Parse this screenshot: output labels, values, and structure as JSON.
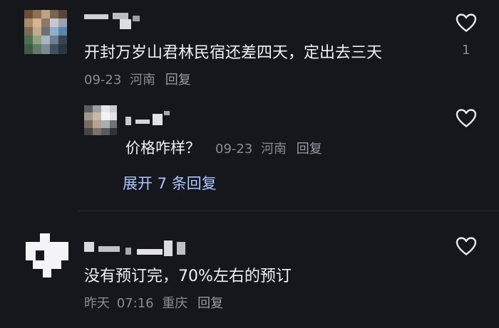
{
  "comments": [
    {
      "text": "开封万岁山君林民宿还差四天，定出去三天",
      "date": "09-23",
      "location": "河南",
      "reply_label": "回复",
      "like_icon": "heart-outline-icon",
      "like_count": "1"
    }
  ],
  "replies": [
    {
      "text": "价格咋样？",
      "date": "09-23",
      "location": "河南",
      "reply_label": "回复",
      "like_icon": "heart-outline-icon"
    }
  ],
  "expand_label": "展开 7 条回复",
  "comment2": {
    "text": "没有预订完，70%左右的预订",
    "date": "昨天",
    "time": "07:16",
    "location": "重庆",
    "reply_label": "回复",
    "like_icon": "heart-outline-icon"
  },
  "colors": {
    "background": "#16161d",
    "text": "#f0f0f4",
    "meta": "#8b8b95",
    "link": "#a9c7ff"
  }
}
